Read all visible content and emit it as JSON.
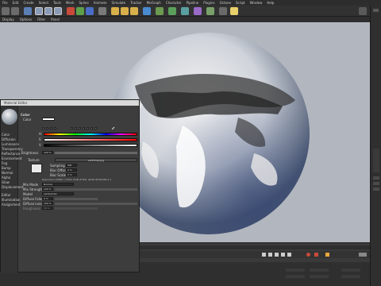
{
  "menubar": {
    "items": [
      "File",
      "Edit",
      "Create",
      "Select",
      "Tools",
      "Mesh",
      "Spline",
      "Animate",
      "Simulate",
      "Tracker",
      "MoGraph",
      "Character",
      "Pipeline",
      "Plugins",
      "Octane",
      "Script",
      "Window",
      "Help"
    ]
  },
  "viewmenu": {
    "items": [
      "Display",
      "Options",
      "Filter",
      "Panel"
    ]
  },
  "material_editor": {
    "title": "Material Editor",
    "section": "Color",
    "color_label": "Color",
    "channel_labels": [
      "Color",
      "Diffusion",
      "Luminance",
      "Transparency",
      "Reflectance",
      "Environment",
      "Fog",
      "Bump",
      "Normal",
      "Alpha",
      "Glow",
      "Displacement",
      "Editor",
      "Illumination",
      "Assignment"
    ],
    "hsv_labels": [
      "H",
      "S",
      "V"
    ],
    "brightness_label": "Brightness",
    "brightness_value": "100 %",
    "texture_label": "Texture",
    "texture_button": "earthmap.jpg",
    "sampling_label": "Sampling",
    "sampling_value": "MIP",
    "blur_offset_label": "Blur Offset",
    "blur_offset_value": "0 %",
    "blur_scale_label": "Blur Scale",
    "blur_scale_value": "0 %",
    "resolution_text": "Resolution 10800 x 5400, RGB (8 Bit), sRGB IEC61966-2.1",
    "mix_mode_label": "Mix Mode",
    "mix_mode_value": "Normal",
    "mix_strength_label": "Mix Strength",
    "mix_strength_value": "100 %",
    "model_label": "Model",
    "model_value": "Lambertian",
    "diffuse_falloff_label": "Diffuse Falloff",
    "diffuse_falloff_value": "0 %",
    "diffuse_level_label": "Diffuse Level",
    "diffuse_level_value": "100 %",
    "roughness_label": "Roughness",
    "roughness_value": "50 %"
  },
  "colors": {
    "viewport_bg": "#b2b6be",
    "accent": "#e8a83c"
  }
}
